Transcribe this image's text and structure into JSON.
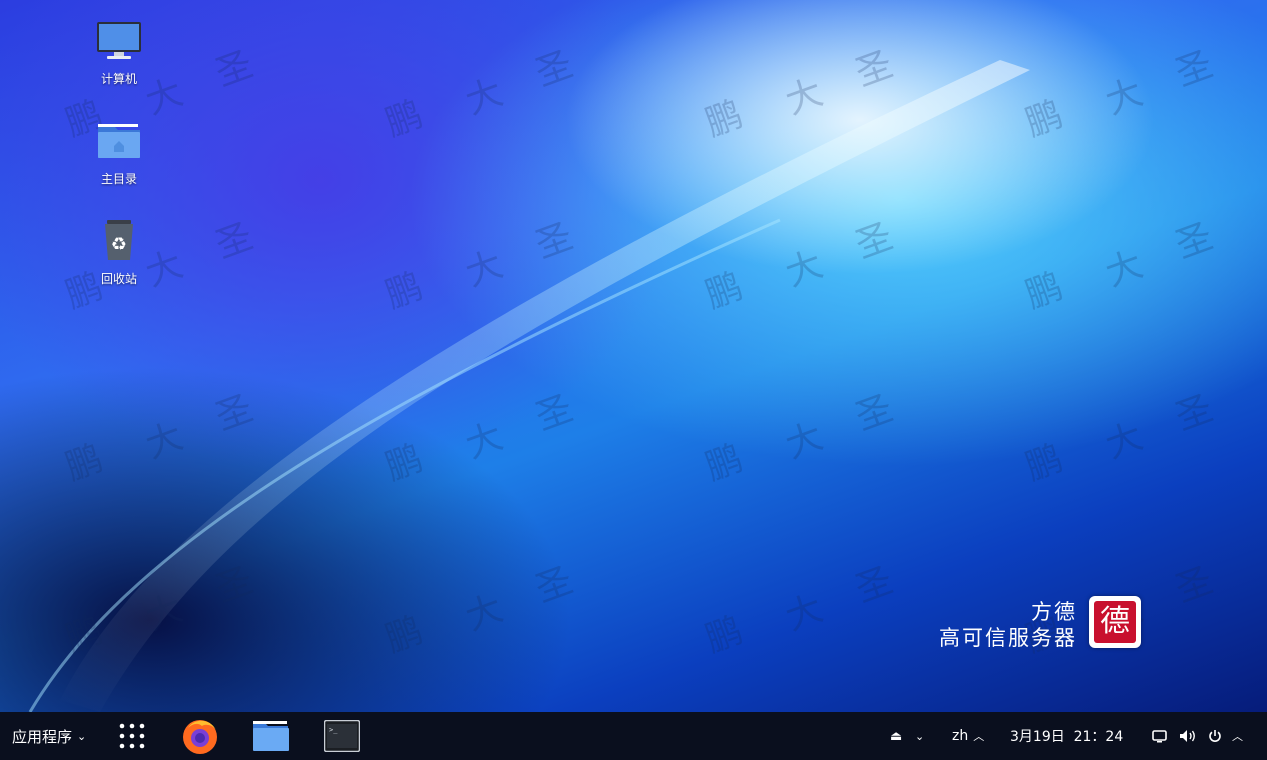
{
  "desktop": {
    "icons": [
      {
        "label": "计算机",
        "icon": "computer-icon"
      },
      {
        "label": "主目录",
        "icon": "home-folder-icon"
      },
      {
        "label": "回收站",
        "icon": "trash-icon"
      }
    ],
    "watermark_chars": [
      "鹏",
      "大",
      "圣"
    ],
    "logo": {
      "line1": "方德",
      "line2": "高可信服务器",
      "seal": "德"
    }
  },
  "taskbar": {
    "apps_menu_label": "应用程序",
    "launchers": [
      {
        "name": "show-apps",
        "icon": "grid-icon"
      },
      {
        "name": "firefox",
        "icon": "firefox-icon"
      },
      {
        "name": "files",
        "icon": "folder-icon"
      },
      {
        "name": "terminal",
        "icon": "terminal-icon"
      }
    ],
    "tray": {
      "eject_icon": "eject-icon",
      "language": "zh",
      "datetime": "3月19日  21：24",
      "display_icon": "display-icon",
      "volume_icon": "volume-icon",
      "power_icon": "power-icon"
    }
  },
  "colors": {
    "taskbar_bg": "#0a0f1e",
    "seal_red": "#c8102e"
  }
}
